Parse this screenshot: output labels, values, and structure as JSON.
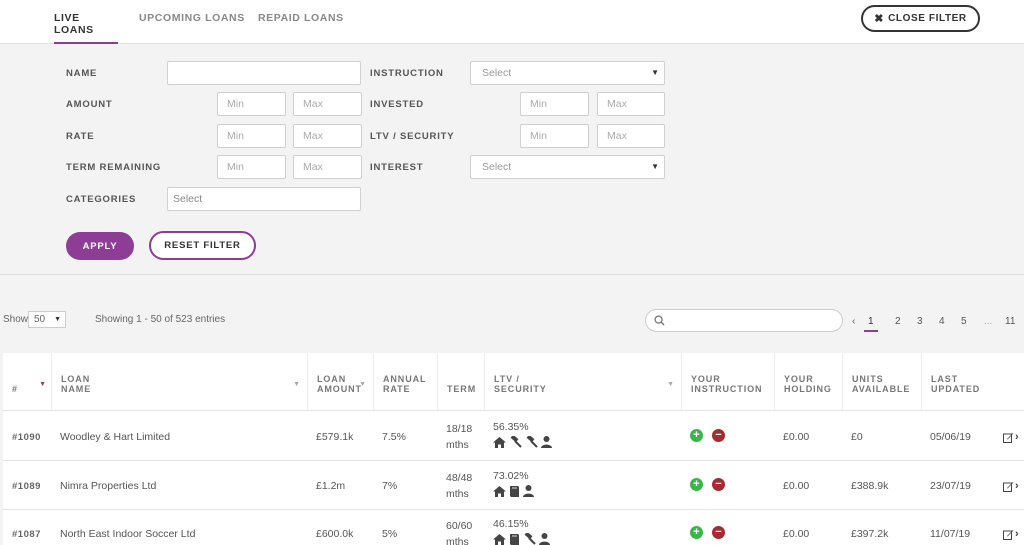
{
  "tabs": [
    "LIVE LOANS",
    "UPCOMING LOANS",
    "REPAID LOANS"
  ],
  "close_filter": "CLOSE FILTER",
  "filter": {
    "name_label": "NAME",
    "amount_label": "AMOUNT",
    "rate_label": "RATE",
    "term_label": "TERM REMAINING",
    "categories_label": "CATEGORIES",
    "instruction_label": "INSTRUCTION",
    "invested_label": "INVESTED",
    "ltv_label": "LTV / SECURITY",
    "interest_label": "INTEREST",
    "min": "Min",
    "max": "Max",
    "select": "Select",
    "apply": "APPLY",
    "reset": "RESET FILTER"
  },
  "controls": {
    "show_label": "Show",
    "show_value": "50",
    "showing": "Showing 1 - 50 of 523 entries",
    "pages": [
      "1",
      "2",
      "3",
      "4",
      "5",
      "...",
      "11"
    ],
    "prev": "‹"
  },
  "columns": [
    {
      "key": "id",
      "label": "#"
    },
    {
      "key": "name",
      "label": "LOAN NAME"
    },
    {
      "key": "amount",
      "label": "LOAN AMOUNT"
    },
    {
      "key": "rate",
      "label": "ANNUAL RATE"
    },
    {
      "key": "term",
      "label": "TERM"
    },
    {
      "key": "ltv",
      "label": "LTV / SECURITY"
    },
    {
      "key": "instruction",
      "label": "YOUR INSTRUCTION"
    },
    {
      "key": "holding",
      "label": "YOUR HOLDING"
    },
    {
      "key": "units",
      "label": "UNITS AVAILABLE"
    },
    {
      "key": "updated",
      "label": "LAST UPDATED"
    }
  ],
  "rows": [
    {
      "id": "#1090",
      "name": "Woodley & Hart Limited",
      "amount": "£579.1k",
      "rate": "7.5%",
      "term_top": "18/18",
      "term_bottom": "mths",
      "ltv": "56.35%",
      "security_icons": [
        "house-icon",
        "gavel-icon",
        "gavel-icon",
        "person-icon"
      ],
      "holding": "£0.00",
      "units": "£0",
      "updated": "05/06/19"
    },
    {
      "id": "#1089",
      "name": "Nimra Properties Ltd",
      "amount": "£1.2m",
      "rate": "7%",
      "term_top": "48/48",
      "term_bottom": "mths",
      "ltv": "73.02%",
      "security_icons": [
        "house-icon",
        "book-icon",
        "person-icon"
      ],
      "holding": "£0.00",
      "units": "£388.9k",
      "updated": "23/07/19"
    },
    {
      "id": "#1087",
      "name": "North East Indoor Soccer Ltd",
      "amount": "£600.0k",
      "rate": "5%",
      "term_top": "60/60",
      "term_bottom": "mths",
      "ltv": "46.15%",
      "security_icons": [
        "house-icon",
        "book-icon",
        "gavel-icon",
        "person-icon"
      ],
      "holding": "£0.00",
      "units": "£397.2k",
      "updated": "11/07/19"
    }
  ],
  "colors": {
    "accent": "#8e3d94",
    "plus": "#3bb54a",
    "minus": "#a52b30"
  }
}
